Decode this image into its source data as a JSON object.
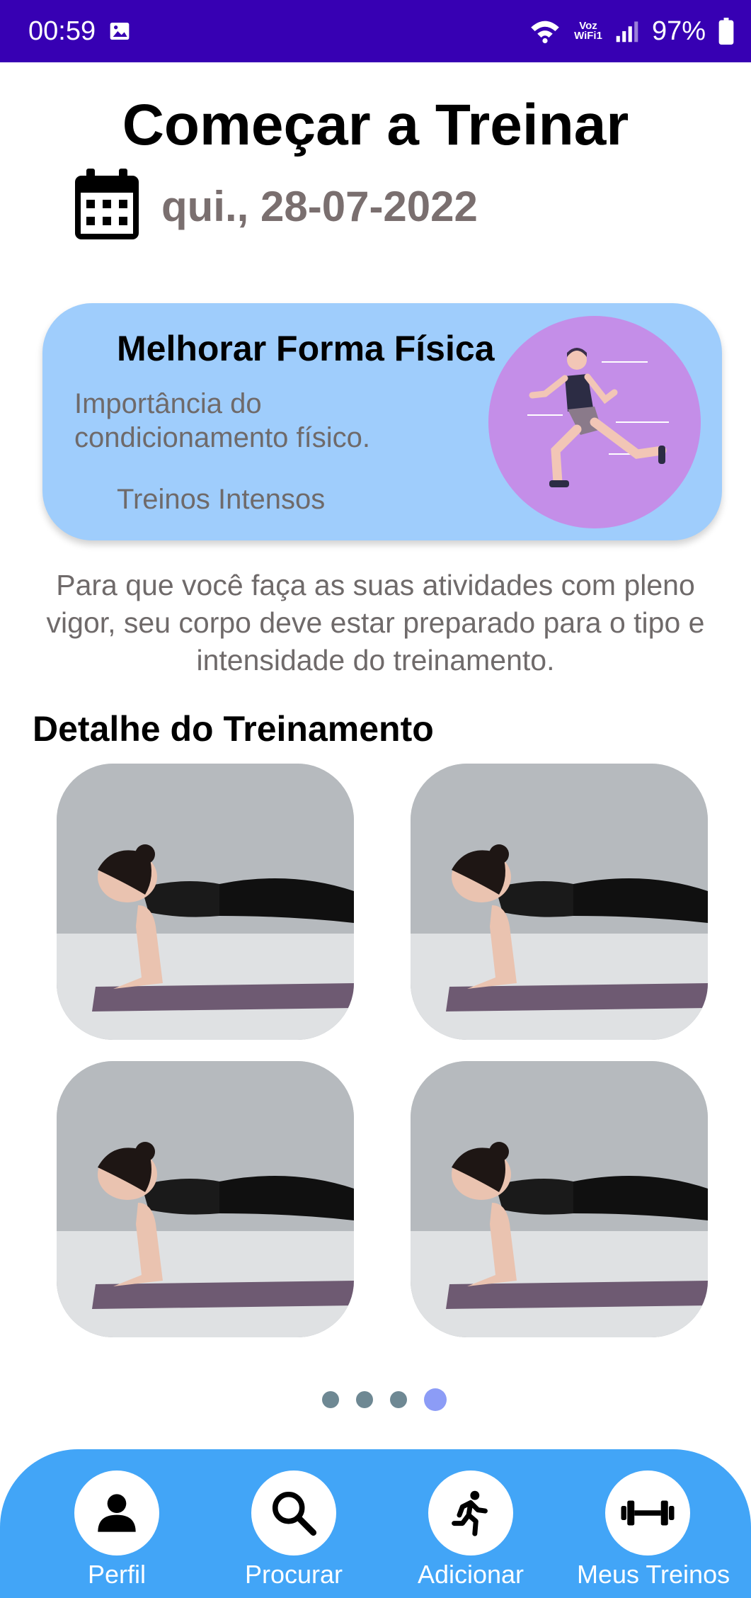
{
  "status_bar": {
    "time": "00:59",
    "network_label_top": "Voz",
    "network_label_bottom": "WiFi1",
    "battery": "97%"
  },
  "header": {
    "title": "Começar a Treinar",
    "date": "qui., 28-07-2022"
  },
  "card": {
    "title": "Melhorar Forma Física",
    "subtitle": "Importância do condicionamento físico.",
    "tag": "Treinos Intensos"
  },
  "description": "Para que você faça as suas atividades com pleno vigor, seu corpo deve estar preparado para o tipo e intensidade do treinamento.",
  "section": {
    "title": "Detalhe do Treinamento"
  },
  "carousel": {
    "page_count": 4,
    "active_page": 4
  },
  "nav": {
    "items": [
      {
        "label": "Perfil",
        "icon": "person-icon"
      },
      {
        "label": "Procurar",
        "icon": "search-icon"
      },
      {
        "label": "Adicionar",
        "icon": "runner-icon"
      },
      {
        "label": "Meus Treinos",
        "icon": "dumbbell-icon"
      }
    ]
  },
  "colors": {
    "status_bar": "#3700b3",
    "card_background": "#9fcdfc",
    "card_circle": "#c48ee8",
    "bottom_nav": "#42a5f7",
    "dot_active": "#8c9cf6",
    "dot_inactive": "#6e8893"
  }
}
